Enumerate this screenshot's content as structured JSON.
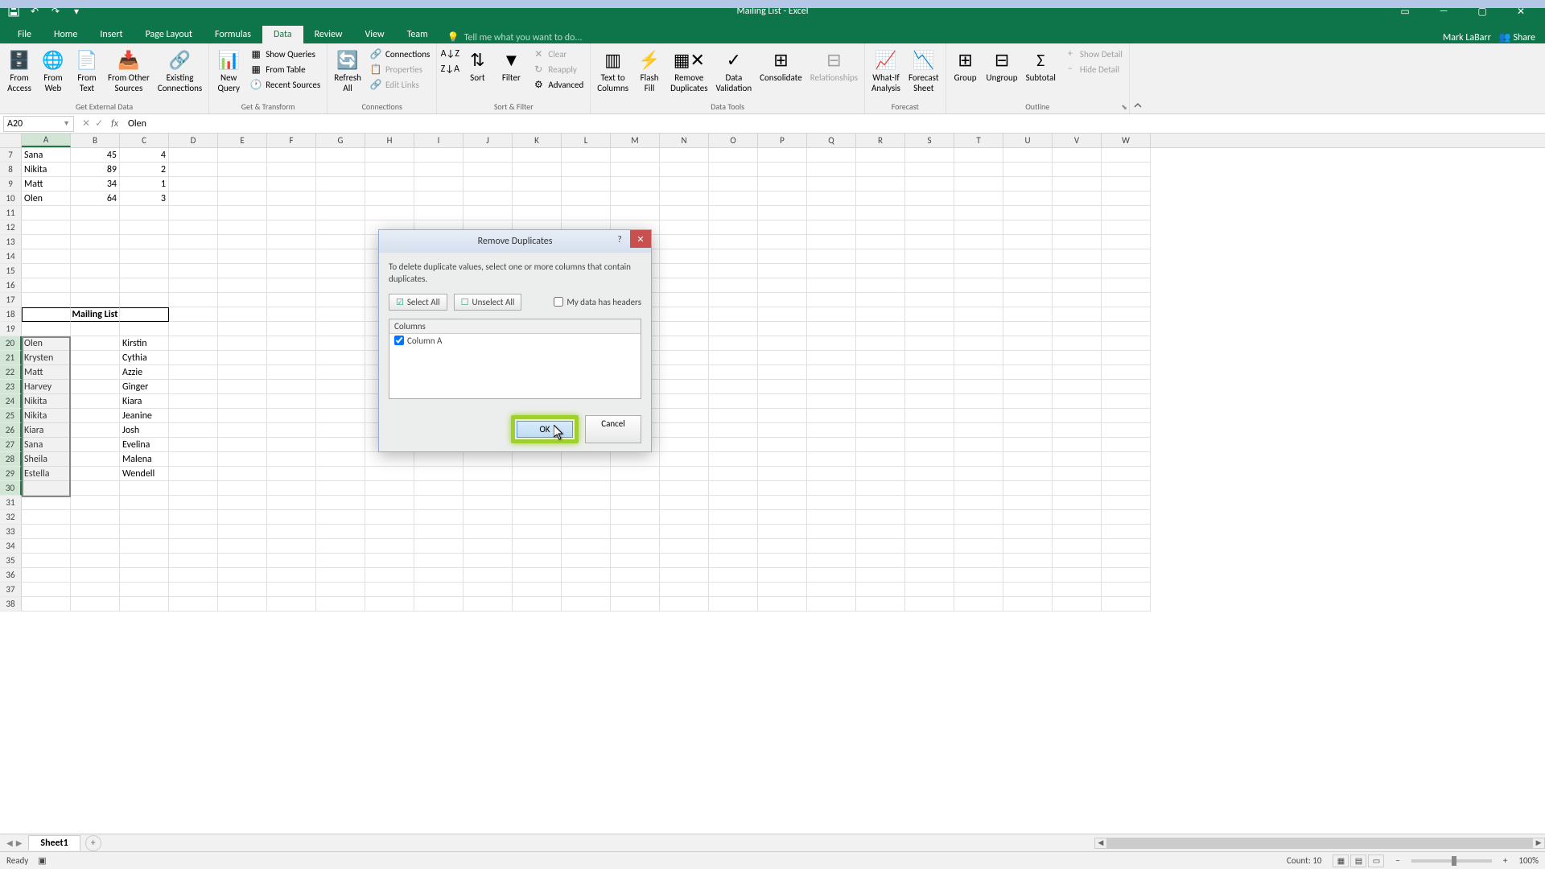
{
  "title_bar": {
    "app_title": "Mailing List - Excel"
  },
  "qat": {
    "save": "💾",
    "undo": "↶",
    "redo": "↷",
    "more": "▾"
  },
  "tabs": {
    "file": "File",
    "home": "Home",
    "insert": "Insert",
    "pagelayout": "Page Layout",
    "formulas": "Formulas",
    "data": "Data",
    "review": "Review",
    "view": "View",
    "team": "Team",
    "tellme": "Tell me what you want to do...",
    "user": "Mark LaBarr",
    "share": "Share"
  },
  "ribbon": {
    "from_access": "From\nAccess",
    "from_web": "From\nWeb",
    "from_text": "From\nText",
    "from_other": "From Other\nSources",
    "existing": "Existing\nConnections",
    "get_external": "Get External Data",
    "new_query": "New\nQuery",
    "show_queries": "Show Queries",
    "from_table": "From Table",
    "recent_sources": "Recent Sources",
    "get_transform": "Get & Transform",
    "refresh": "Refresh\nAll",
    "connections": "Connections",
    "properties": "Properties",
    "edit_links": "Edit Links",
    "connections_grp": "Connections",
    "sort": "Sort",
    "filter": "Filter",
    "clear": "Clear",
    "reapply": "Reapply",
    "advanced": "Advanced",
    "sort_filter": "Sort & Filter",
    "text_to_cols": "Text to\nColumns",
    "flash_fill": "Flash\nFill",
    "remove_dup": "Remove\nDuplicates",
    "data_val": "Data\nValidation",
    "consolidate": "Consolidate",
    "relationships": "Relationships",
    "data_tools": "Data Tools",
    "whatif": "What-If\nAnalysis",
    "forecast_sheet": "Forecast\nSheet",
    "forecast": "Forecast",
    "group": "Group",
    "ungroup": "Ungroup",
    "subtotal": "Subtotal",
    "show_detail": "Show Detail",
    "hide_detail": "Hide Detail",
    "outline": "Outline"
  },
  "formula_bar": {
    "name_box": "A20",
    "formula_value": "Olen"
  },
  "columns": [
    "A",
    "B",
    "C",
    "D",
    "E",
    "F",
    "G",
    "H",
    "I",
    "J",
    "K",
    "L",
    "M",
    "N",
    "O",
    "P",
    "Q",
    "R",
    "S",
    "T",
    "U",
    "V",
    "W"
  ],
  "rows": {
    "start": 7,
    "end": 38,
    "data": {
      "7": {
        "A": "Sana",
        "B": "45",
        "C": "4"
      },
      "8": {
        "A": "Nikita",
        "B": "89",
        "C": "2"
      },
      "9": {
        "A": "Matt",
        "B": "34",
        "C": "1"
      },
      "10": {
        "A": "Olen",
        "B": "64",
        "C": "3"
      },
      "18": {
        "B": "Mailing List",
        "B_bold": true
      },
      "20": {
        "A": "Olen",
        "C": "Kirstin"
      },
      "21": {
        "A": "Krysten",
        "C": "Cythia"
      },
      "22": {
        "A": "Matt",
        "C": "Azzie"
      },
      "23": {
        "A": "Harvey",
        "C": "Ginger"
      },
      "24": {
        "A": "Nikita",
        "C": "Kiara"
      },
      "25": {
        "A": "Nikita",
        "C": "Jeanine"
      },
      "26": {
        "A": "Kiara",
        "C": "Josh"
      },
      "27": {
        "A": "Sana",
        "C": "Evelina"
      },
      "28": {
        "A": "Sheila",
        "C": "Malena"
      },
      "29": {
        "A": "Estella",
        "C": "Wendell"
      }
    }
  },
  "dialog": {
    "title": "Remove Duplicates",
    "message": "To delete duplicate values, select one or more columns that contain duplicates.",
    "select_all": "Select All",
    "unselect_all": "Unselect All",
    "headers_chk": "My data has headers",
    "list_header": "Columns",
    "column_a": "Column A",
    "ok": "OK",
    "cancel": "Cancel"
  },
  "sheet_tabs": {
    "sheet1": "Sheet1"
  },
  "status": {
    "ready": "Ready",
    "count_label": "Count: 10",
    "zoom": "100%"
  }
}
